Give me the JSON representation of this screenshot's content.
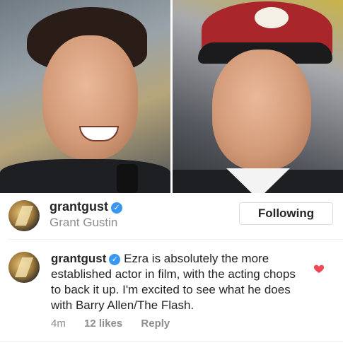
{
  "post": {
    "image_description_alt": "",
    "author": {
      "username": "grantgust",
      "full_name": "Grant Gustin",
      "verified": true
    },
    "follow_button_label": "Following"
  },
  "comment": {
    "username": "grantgust",
    "text": "Ezra is absolutely the more established actor in film, with the acting chops to back it up. I'm excited to see what he does with Barry Allen/The Flash.",
    "time": "4m",
    "likes": "12 likes",
    "reply_label": "Reply",
    "liked": true
  },
  "colors": {
    "verified_badge": "#3897f0",
    "heart": "#ed4956",
    "secondary_text": "#8e8e8e",
    "primary_text": "#262626"
  },
  "icons": {
    "verified": "verified-badge-icon",
    "heart": "heart-icon"
  }
}
